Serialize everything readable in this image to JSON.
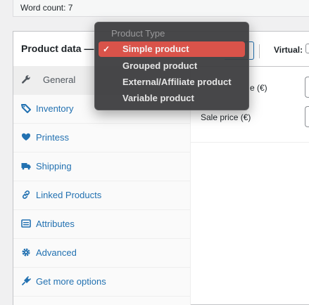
{
  "word_count": {
    "text": "Word count: 7"
  },
  "product_data": {
    "title": "Product data —",
    "virtual_label": "Virtual:"
  },
  "product_type_dropdown": {
    "group_label": "Product Type",
    "check_mark": "✓",
    "selected_index": 0,
    "options": [
      {
        "label": "Simple product"
      },
      {
        "label": "Grouped product"
      },
      {
        "label": "External/Affiliate product"
      },
      {
        "label": "Variable product"
      }
    ]
  },
  "tabs": [
    {
      "label": "General",
      "icon": "wrench-icon"
    },
    {
      "label": "Inventory",
      "icon": "tag-icon"
    },
    {
      "label": "Printess",
      "icon": "heart-icon"
    },
    {
      "label": "Shipping",
      "icon": "truck-icon"
    },
    {
      "label": "Linked Products",
      "icon": "link-icon"
    },
    {
      "label": "Attributes",
      "icon": "list-icon"
    },
    {
      "label": "Advanced",
      "icon": "gear-icon"
    },
    {
      "label": "Get more options",
      "icon": "plugin-icon"
    }
  ],
  "general_fields": {
    "regular_price_label": "e (€)",
    "sale_price_label": "Sale price (€)"
  },
  "colors": {
    "link": "#2271b1",
    "selected_option": "#d9534a",
    "dropdown_bg": "#3c3c3e"
  }
}
